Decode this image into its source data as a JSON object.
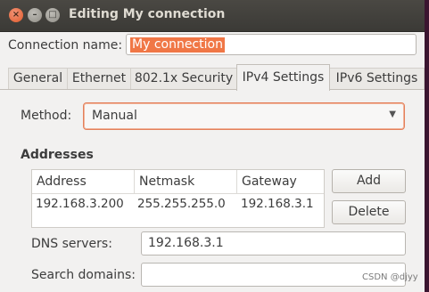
{
  "window": {
    "title": "Editing My connection",
    "close_glyph": "×",
    "min_glyph": "–",
    "max_glyph": "□"
  },
  "connection": {
    "label": "Connection name:",
    "value": "My connection"
  },
  "tabs": [
    {
      "label": "General"
    },
    {
      "label": "Ethernet"
    },
    {
      "label": "802.1x Security"
    },
    {
      "label": "IPv4 Settings",
      "active": true
    },
    {
      "label": "IPv6 Settings"
    }
  ],
  "method": {
    "label": "Method:",
    "value": "Manual"
  },
  "addresses": {
    "title": "Addresses",
    "columns": [
      "Address",
      "Netmask",
      "Gateway"
    ],
    "rows": [
      [
        "192.168.3.200",
        "255.255.255.0",
        "192.168.3.1"
      ]
    ],
    "add_label": "Add",
    "delete_label": "Delete"
  },
  "dns": {
    "label": "DNS servers:",
    "value": "192.168.3.1"
  },
  "search_domains": {
    "label": "Search domains:",
    "value": ""
  },
  "watermark": "CSDN @djyy"
}
